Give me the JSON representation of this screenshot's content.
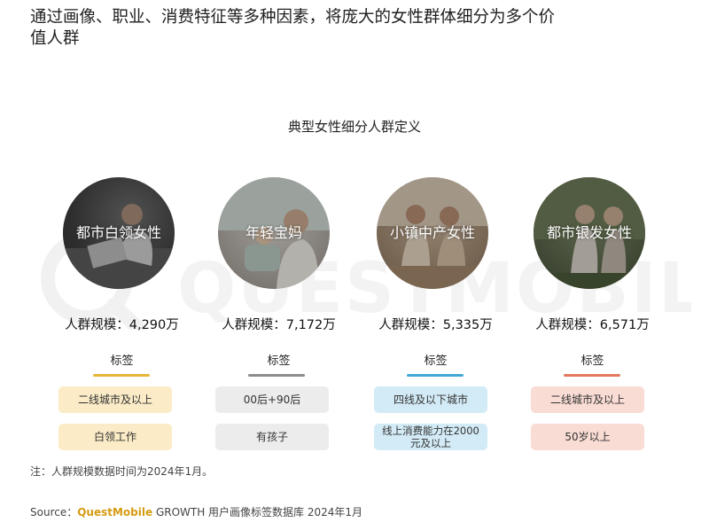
{
  "headline": "通过画像、职业、消费特征等多种因素，将庞大的女性群体细分为多个价值人群",
  "watermark": "QUESTMOBILE",
  "section_title": "典型女性细分人群定义",
  "tag_title": "标签",
  "groups": [
    {
      "name": "都市白领女性",
      "scale": "人群规模：4,290万",
      "accent": "#e8b53a",
      "pill_bg": "#fbecc7",
      "tags": [
        "二线城市及以上",
        "白领工作"
      ]
    },
    {
      "name": "年轻宝妈",
      "scale": "人群规模：7,172万",
      "accent": "#8c8c8c",
      "pill_bg": "#ececec",
      "tags": [
        "00后+90后",
        "有孩子"
      ]
    },
    {
      "name": "小镇中产女性",
      "scale": "人群规模：5,335万",
      "accent": "#44a6d6",
      "pill_bg": "#d3ebf6",
      "tags": [
        "四线及以下城市",
        "线上消费能力在2000元及以上"
      ]
    },
    {
      "name": "都市银发女性",
      "scale": "人群规模：6,571万",
      "accent": "#e4785e",
      "pill_bg": "#f9dcd4",
      "tags": [
        "二线城市及以上",
        "50岁以上"
      ]
    }
  ],
  "note": "注：人群规模数据时间为2024年1月。",
  "source": {
    "prefix": "Source：",
    "brand": "QuestMobile",
    "rest": " GROWTH 用户画像标签数据库 2024年1月"
  }
}
